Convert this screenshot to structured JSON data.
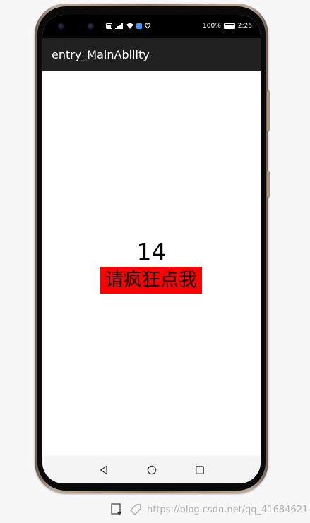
{
  "status_bar": {
    "battery_percent": "100%",
    "time": "2:26"
  },
  "app_bar": {
    "title": "entry_MainAbility"
  },
  "main": {
    "counter_value": "14",
    "button_label": "请疯狂点我",
    "button_color": "#ff0000"
  },
  "watermark": {
    "text": "https://blog.csdn.net/qq_41684621"
  },
  "icons": {
    "status": [
      "nfc-icon",
      "signal-icon",
      "wifi-icon",
      "app-notification-icon",
      "heart-icon",
      "battery-icon"
    ],
    "nav": [
      "back-icon",
      "home-icon",
      "recents-icon"
    ]
  }
}
